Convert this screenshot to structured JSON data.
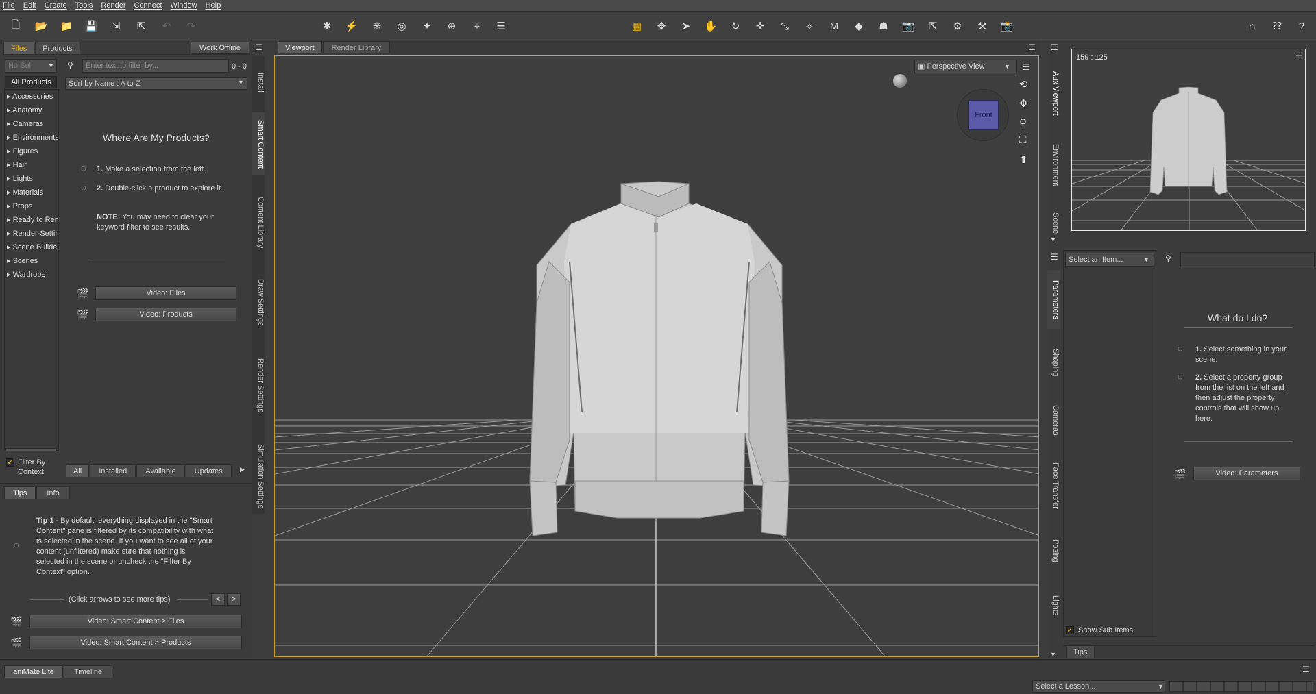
{
  "menu": [
    "File",
    "Edit",
    "Create",
    "Tools",
    "Render",
    "Connect",
    "Window",
    "Help"
  ],
  "left": {
    "tabs": [
      "Files",
      "Products"
    ],
    "work_offline": "Work Offline",
    "filter_placeholder": "Enter text to filter by...",
    "filter_count": "0 - 0",
    "sort": "Sort by Name : A to Z",
    "small_select": "No Sel",
    "all_products": "All Products",
    "categories": [
      "Accessories",
      "Anatomy",
      "Cameras",
      "Environments",
      "Figures",
      "Hair",
      "Lights",
      "Materials",
      "Props",
      "Ready to Render",
      "Render-Settings",
      "Scene Builder",
      "Scenes",
      "Wardrobe"
    ],
    "heading": "Where Are My Products?",
    "step1_num": "1.",
    "step1": "Make a selection from the left.",
    "step2_num": "2.",
    "step2": "Double-click a product to explore it.",
    "note_label": "NOTE:",
    "note_line1": "You may need to clear your",
    "note_line2": "keyword filter to see results.",
    "video_files": "Video: Files",
    "video_products": "Video: Products",
    "filter_context_1": "Filter By",
    "filter_context_2": "Context",
    "bottom_tabs": [
      "All",
      "Installed",
      "Available",
      "Updates"
    ],
    "vtabs": [
      "Install",
      "Smart Content",
      "Content Library",
      "Draw Settings",
      "Render Settings",
      "Simulation Settings"
    ]
  },
  "tips": {
    "tabs": [
      "Tips",
      "Info"
    ],
    "tip_label": "Tip 1",
    "tip_lines": [
      " - By default, everything displayed in the \"Smart",
      "Content\" pane is filtered by its compatibility with what",
      "is selected in the scene. If you want to see all of your",
      "content (unfiltered) make sure that nothing is",
      "selected in the scene or uncheck the \"Filter By",
      "Context\" option."
    ],
    "more": "(Click arrows to see more tips)",
    "prev": "<",
    "next": ">",
    "video_sc_files": "Video: Smart Content > Files",
    "video_sc_products": "Video: Smart Content > Products"
  },
  "viewport": {
    "tabs": [
      "Viewport",
      "Render Library"
    ],
    "view": "Perspective View",
    "cube": "Front"
  },
  "right": {
    "aux_size": "159 : 125",
    "aux_vtabs": [
      "Aux Viewport",
      "Environment",
      "Scene"
    ],
    "param_vtabs": [
      "Parameters",
      "Shaping",
      "Cameras",
      "Face Transfer",
      "Posing",
      "Lights"
    ],
    "select_item": "Select an Item...",
    "heading": "What do I do?",
    "step1_num": "1.",
    "step1_lines": [
      "Select something in your",
      "scene."
    ],
    "step2_num": "2.",
    "step2_lines": [
      "Select a property group",
      "from the list on the left and",
      "then adjust the property",
      "controls that will show up",
      "here."
    ],
    "video_params": "Video: Parameters",
    "show_sub": "Show Sub Items",
    "tips_tab": "Tips"
  },
  "bottom": {
    "tabs": [
      "aniMate Lite",
      "Timeline"
    ],
    "lesson": "Select a Lesson..."
  },
  "colors": {
    "accent": "#e8b418",
    "viewport_border": "#c9a227",
    "cube": "#5a5aa8"
  }
}
